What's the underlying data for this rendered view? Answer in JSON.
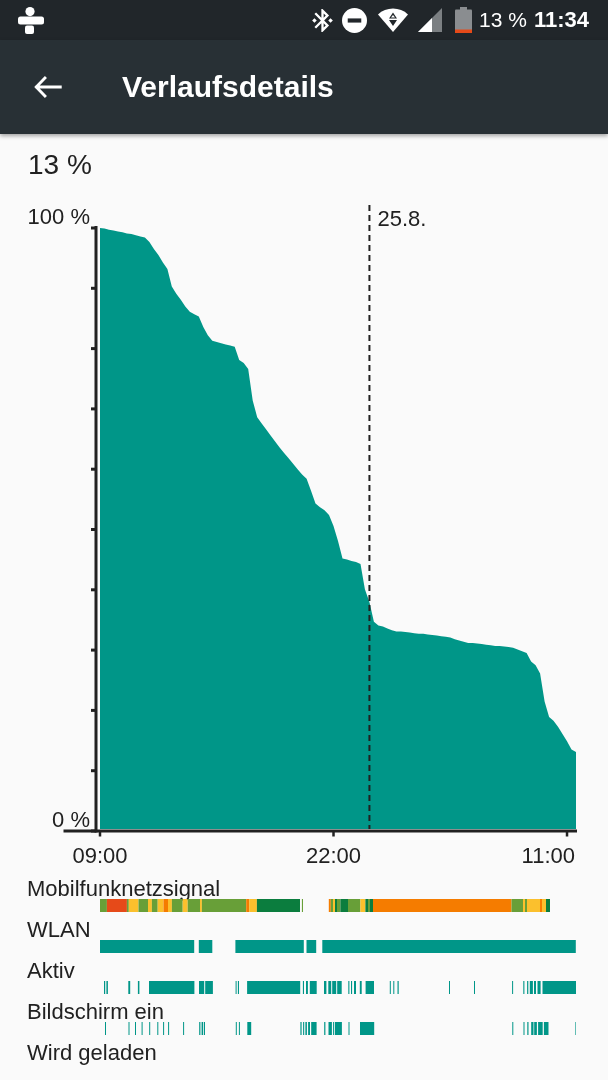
{
  "status_bar": {
    "battery_text": "13 %",
    "time": "11:34"
  },
  "app_bar": {
    "title": "Verlaufsdetails"
  },
  "header": {
    "charge_text": "13 %"
  },
  "chart": {
    "chart_data": {
      "type": "area",
      "categories": [
        "09:00",
        null,
        null,
        null,
        null,
        null,
        null,
        null,
        null,
        null,
        null,
        null,
        null,
        null,
        null,
        null,
        null,
        null,
        null,
        null,
        null,
        null,
        null,
        null,
        null,
        null,
        null,
        null,
        null,
        null,
        null,
        null,
        null,
        null,
        null,
        null,
        null,
        null,
        null,
        null,
        null,
        null,
        null,
        null,
        null,
        null,
        null,
        null,
        null,
        null,
        null,
        null,
        "22:00",
        null,
        null,
        null,
        null,
        null,
        null,
        null,
        null,
        null,
        null,
        null,
        null,
        null,
        null,
        null,
        null,
        null,
        null,
        null,
        null,
        null,
        null,
        null,
        null,
        null,
        null,
        null,
        null,
        null,
        null,
        null,
        null,
        null,
        null,
        null,
        null,
        null,
        null,
        null,
        null,
        null,
        null,
        null,
        null,
        null,
        null,
        null,
        null,
        null,
        null,
        null,
        "11:00",
        null,
        null
      ],
      "series": [
        {
          "color": "#009688",
          "values": [
            100,
            99.9,
            99.7,
            99.6,
            99.4,
            99.3,
            99.1,
            99,
            98.8,
            98.6,
            98.4,
            97.7,
            96.5,
            95.5,
            94.3,
            93.2,
            90.3,
            89.1,
            88.1,
            87,
            86.1,
            85.7,
            85.3,
            83.6,
            82.2,
            81.3,
            81.1,
            80.9,
            80.7,
            80.5,
            80.3,
            78.1,
            77.6,
            76.6,
            71.4,
            68.6,
            67.6,
            66.6,
            65.6,
            64.6,
            63.6,
            62.7,
            61.8,
            60.9,
            60,
            59.1,
            58.4,
            56.4,
            54.3,
            53.7,
            53.2,
            52.4,
            50.6,
            48.1,
            45.2,
            45,
            44.8,
            44.6,
            44.3,
            40.1,
            38,
            34.7,
            34.1,
            33.9,
            33.6,
            33.3,
            33.1,
            33.1,
            33,
            32.9,
            32.8,
            32.7,
            32.7,
            32.6,
            32.5,
            32.4,
            32.3,
            32.2,
            32.1,
            31.8,
            31.6,
            31.4,
            31.2,
            31.2,
            31.1,
            31,
            30.9,
            30.8,
            30.7,
            30.7,
            30.6,
            30.5,
            30.4,
            30.1,
            29.8,
            29.5,
            28.1,
            27.5,
            26.1,
            21.5,
            18.9,
            18.3,
            17.3,
            16.1,
            14.9,
            13.5,
            13.1
          ]
        }
      ],
      "ylim": [
        0,
        100
      ],
      "yticks": [
        {
          "value": 0,
          "label": "0 %"
        },
        {
          "value": 100,
          "label": "100 %"
        }
      ],
      "annotations": [
        "25.8."
      ]
    }
  },
  "timelines": [
    {
      "label": "Mobilfunknetzsignal",
      "kind": "signal"
    },
    {
      "label": "WLAN",
      "kind": "wlan"
    },
    {
      "label": "Aktiv",
      "kind": "awake"
    },
    {
      "label": "Bildschirm ein",
      "kind": "screen"
    },
    {
      "label": "Wird geladen",
      "kind": "charging"
    }
  ]
}
